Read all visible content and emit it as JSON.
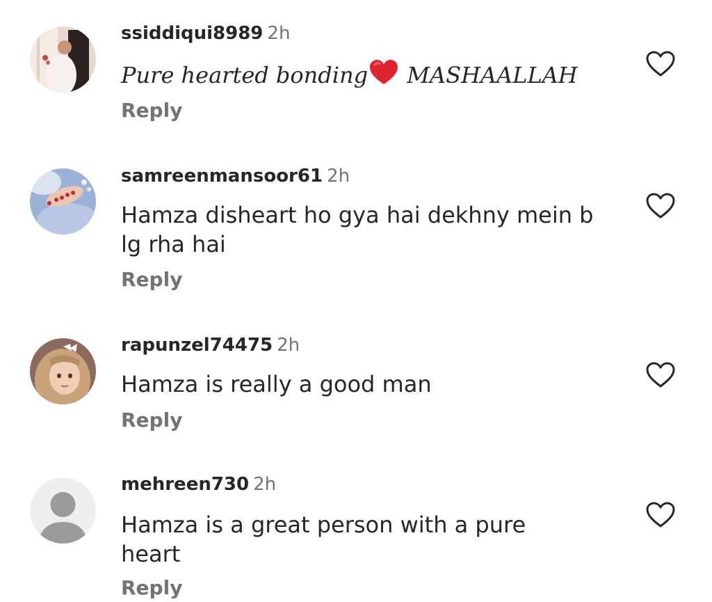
{
  "comments": [
    {
      "username": "ssiddiqui8989",
      "time": "2h",
      "text_before": "Pure hearted bonding",
      "emoji": "red-heart",
      "text_after": " MASHAALLAH",
      "reply_label": "Reply"
    },
    {
      "username": "samreenmansoor61",
      "time": "2h",
      "text": "Hamza disheart ho gya hai dekhny mein b lg rha hai",
      "reply_label": "Reply"
    },
    {
      "username": "rapunzel74475",
      "time": "2h",
      "text": "Hamza is really a good man",
      "reply_label": "Reply"
    },
    {
      "username": "mehreen730",
      "time": "2h",
      "text": "Hamza is a great person with a pure heart",
      "reply_label": "Reply"
    }
  ],
  "colors": {
    "text_primary": "#262626",
    "text_secondary": "#737373",
    "emoji_heart": "#e0242f"
  },
  "icons": {
    "like": "heart-outline-icon",
    "default_avatar": "person-silhouette-icon"
  }
}
